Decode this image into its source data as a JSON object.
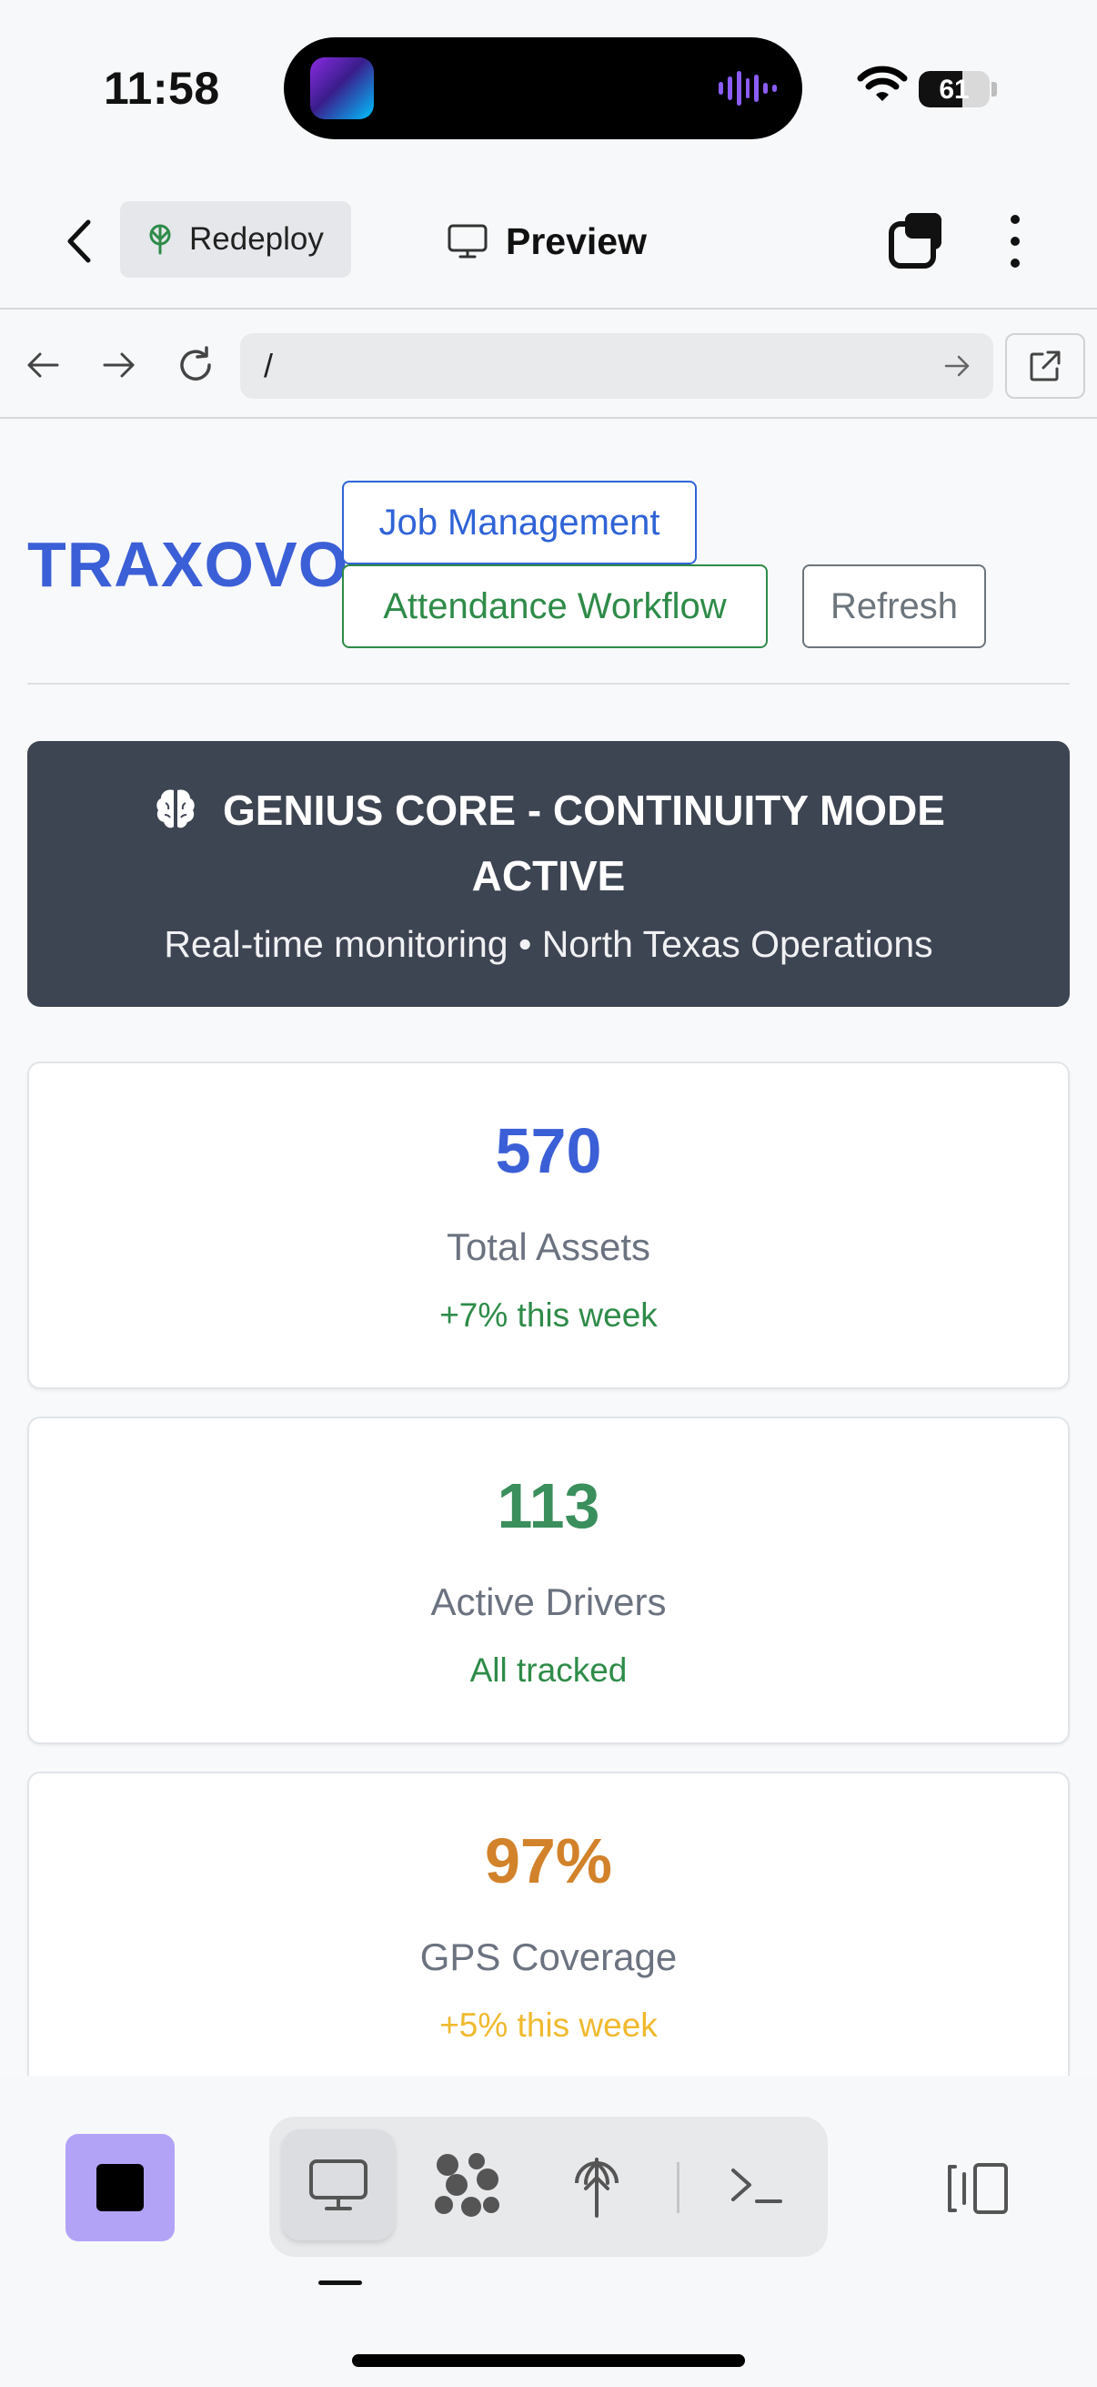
{
  "status_bar": {
    "time": "11:58",
    "battery_level": "61",
    "battery_fraction": 0.61,
    "wifi_icon": "wifi-icon"
  },
  "header": {
    "redeploy_label": "Redeploy",
    "preview_label": "Preview",
    "icons": [
      "chevron-left-icon",
      "deploy-tree-icon",
      "monitor-icon",
      "tabs-icon",
      "more-vertical-icon"
    ]
  },
  "url_bar": {
    "url_value": "/",
    "icons": [
      "arrow-left-icon",
      "arrow-right-icon",
      "reload-icon",
      "go-arrow-icon",
      "open-external-icon"
    ]
  },
  "page": {
    "brand": "TRAXOVO",
    "nav_buttons": {
      "job_management": "Job Management",
      "attendance_workflow": "Attendance Workflow",
      "refresh": "Refresh"
    },
    "hero": {
      "title": "GENIUS CORE - CONTINUITY MODE ACTIVE",
      "subtitle": "Real-time monitoring • North Texas Operations",
      "icon": "brain-icon"
    },
    "stats": [
      {
        "value": "570",
        "label": "Total Assets",
        "note": "+7% this week",
        "value_color": "#3b5fd6",
        "note_color": "#2e8b48"
      },
      {
        "value": "113",
        "label": "Active Drivers",
        "note": "All tracked",
        "value_color": "#3a8f5c",
        "note_color": "#2e8b48"
      },
      {
        "value": "97%",
        "label": "GPS Coverage",
        "note": "+5% this week",
        "value_color": "#d2822a",
        "note_color": "#f0b92e"
      }
    ]
  },
  "toolbar": {
    "icons": [
      "stop-icon",
      "desktop-icon",
      "workflow-icon",
      "deploy-icon",
      "terminal-icon",
      "side-panel-icon"
    ],
    "active_tool": "desktop"
  },
  "colors": {
    "accent_blue": "#2f63d6",
    "accent_green": "#2e8b48",
    "hero_bg": "#3d4452",
    "stop_button": "#b3a3f7"
  }
}
